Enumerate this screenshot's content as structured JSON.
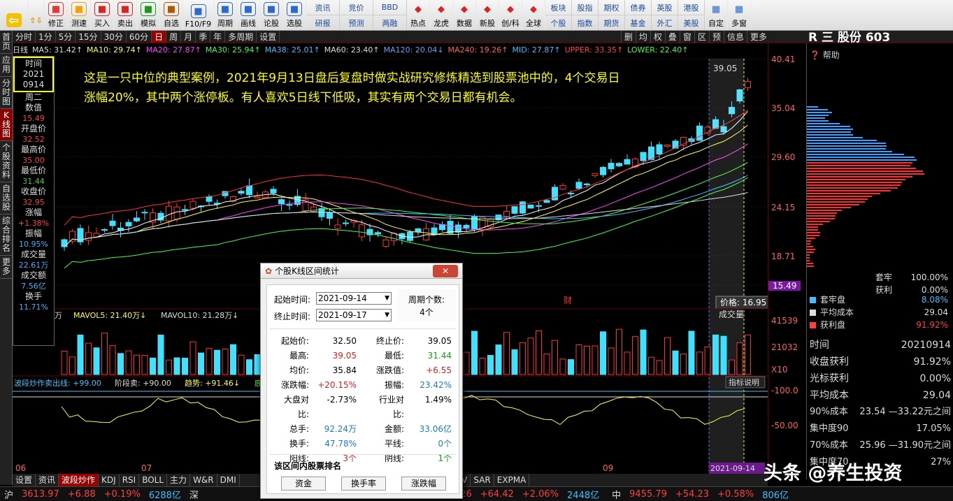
{
  "toolbar": {
    "left_buttons": [
      "修正",
      "测速",
      "买入",
      "卖出",
      "模拟",
      "自选",
      "F10/F9",
      "周期",
      "画线",
      "论股",
      "选股"
    ],
    "pairs": [
      [
        "资讯",
        "研报"
      ],
      [
        "竞价",
        "预测"
      ],
      [
        "BBD",
        "两融"
      ],
      [
        "陆港",
        "热点"
      ],
      [
        "龙虎",
        "数据"
      ],
      [
        "新股",
        "新股"
      ],
      [
        "创/科",
        "创/科"
      ]
    ],
    "more_buttons": [
      "热点",
      "龙虎",
      "数据",
      "新股",
      "创/科",
      "全球"
    ],
    "right_pairs": [
      [
        "板块",
        "个股"
      ],
      [
        "股指",
        "指数"
      ],
      [
        "期权",
        "期货"
      ],
      [
        "债券",
        "基金"
      ],
      [
        "英股",
        "外汇"
      ],
      [
        "港股",
        "美股"
      ]
    ],
    "right_buttons": [
      "自定",
      "多窗"
    ]
  },
  "tabs": [
    "分时",
    "1分",
    "5分",
    "15分",
    "30分",
    "60分",
    "日",
    "周",
    "月",
    "季",
    "年",
    "多周期",
    "设置"
  ],
  "active_tab": "日",
  "tabs_right": [
    "删",
    "均",
    "权",
    "叠",
    "窗",
    "区",
    "预",
    "信息",
    "更多"
  ],
  "leftnav": [
    "首页",
    "应用",
    "分时图",
    "K线图",
    "个股资料",
    "自选股",
    "综合排名",
    "更多"
  ],
  "leftnav_active": "K线图",
  "ma_line": [
    {
      "text": "日线",
      "color": "#ddd"
    },
    {
      "text": "MA5: 31.42↑",
      "color": "#ddd"
    },
    {
      "text": "MA10: 29.74↑",
      "color": "#ffff40"
    },
    {
      "text": "MA20: 27.87↑",
      "color": "#ff40ff"
    },
    {
      "text": "MA30: 25.94↑",
      "color": "#40ff40"
    },
    {
      "text": "MA38: 25.01↑",
      "color": "#40c0ff"
    },
    {
      "text": "MA60: 23.40↑",
      "color": "#ddd"
    },
    {
      "text": "MA120: 20.04↓",
      "color": "#6aa0ff"
    },
    {
      "text": "MA240: 19.26↑",
      "color": "#ff6060"
    },
    {
      "text": "MID: 27.87↑",
      "color": "#40c0ff"
    },
    {
      "text": "UPPER: 33.35↑",
      "color": "#ff4040"
    },
    {
      "text": "LOWER: 22.40↑",
      "color": "#40ff40"
    }
  ],
  "info_panel": {
    "time_label": "时间",
    "year": "2021",
    "date": "0914",
    "weekday": "周二",
    "items": [
      {
        "label": "数值",
        "value": "15.49",
        "cls": ""
      },
      {
        "label": "开盘价",
        "value": "32.52",
        "cls": ""
      },
      {
        "label": "最高价",
        "value": "35.00",
        "cls": ""
      },
      {
        "label": "最低价",
        "value": "31.44",
        "cls": "vg"
      },
      {
        "label": "收盘价",
        "value": "32.95",
        "cls": ""
      },
      {
        "label": "涨幅",
        "value": "+1.38%",
        "cls": ""
      },
      {
        "label": "振幅",
        "value": "10.95%",
        "cls": "vc"
      },
      {
        "label": "成交量",
        "value": "22.61万",
        "cls": "vc"
      },
      {
        "label": "成交额",
        "value": "7.56亿",
        "cls": "vc"
      },
      {
        "label": "换手",
        "value": "11.71%",
        "cls": "vc"
      }
    ]
  },
  "annotation": "这是一只中位的典型案例，2021年9月13日盘后复盘时做实战研究修炼精选到股票池中的，4个交易日涨幅20%，其中两个涨停板。有人喜欢5日线下低吸，其实有两个交易日都有机会。",
  "price_axis": [
    "40.41",
    "35.04",
    "29.60",
    "24.15",
    "18.71",
    "15.49"
  ],
  "vol_axis": [
    "41539",
    "21032",
    "X10"
  ],
  "osc_axis": [
    "100.0",
    "50.00"
  ],
  "chart_labels": {
    "peak": "39.05",
    "price_tip": "价格: 16.95",
    "fin_mark": "财",
    "vol_label": "成交量",
    "indicator_btn": "指标说明",
    "date_highlight": "2021-09-14"
  },
  "vol_legend": [
    {
      "text": "万",
      "color": "#ddd"
    },
    {
      "text": "MAVOL5: 21.40万↓",
      "color": "#ffff40"
    },
    {
      "text": "MAVOL10: 21.28万↓",
      "color": "#ddd"
    }
  ],
  "osc_legend": [
    {
      "text": "波段炒作",
      "color": "#40c0ff"
    },
    {
      "text": "卖出线: +99.00",
      "color": "#40c0ff"
    },
    {
      "text": "阶段卖: +90.00",
      "color": "#ddd"
    },
    {
      "text": "趋势: +91.46↓",
      "color": "#ffff40"
    },
    {
      "text": "底部: +10",
      "color": "#40ff40"
    }
  ],
  "x_labels": [
    "06",
    "07",
    "08",
    "09"
  ],
  "bottom_tabs": [
    "设置",
    "资讯",
    "波段炒作",
    "KDJ",
    "RSI",
    "BOLL",
    "主力",
    "W&R",
    "DMI",
    "BBI",
    "MTM",
    "OBV",
    "SAR",
    "EXPMA"
  ],
  "bottom_tabs_active": "波段炒作",
  "right_panel": {
    "title": "R 三 股份 603",
    "help": "帮助",
    "legend": [
      {
        "label": "套牢",
        "value": "100.00%",
        "color": "#ddd"
      },
      {
        "label": "获利",
        "value": "0.00%",
        "color": "#ddd"
      }
    ],
    "legend2": [
      {
        "label": "套牢盘",
        "value": "8.08%",
        "color": "#40c0ff"
      },
      {
        "label": "平均成本",
        "value": "29.04",
        "color": "#ddd"
      },
      {
        "label": "获利盘",
        "value": "91.92%",
        "color": "#ff4040"
      }
    ],
    "rows": [
      {
        "k": "时间",
        "v": "20210914"
      },
      {
        "k": "收盘获利",
        "v": "91.92%"
      },
      {
        "k": "光标获利",
        "v": "0.00%"
      },
      {
        "k": "平均成本",
        "v": "29.04"
      },
      {
        "k": "90%成本",
        "v": "23.54 —33.22元之间"
      },
      {
        "k": "集中度90",
        "v": "17.05%"
      },
      {
        "k": "70%成本",
        "v": "25.96 —31.90元之间"
      },
      {
        "k": "集中度70",
        "v": "27%"
      }
    ]
  },
  "statusbar": [
    {
      "text": "沪",
      "color": "#ddd"
    },
    {
      "text": "3613.97",
      "color": "#ff4040"
    },
    {
      "text": "+6.88",
      "color": "#ff4040"
    },
    {
      "text": "+0.19%",
      "color": "#ff4040"
    },
    {
      "text": "6288亿",
      "color": "#40c0ff"
    },
    {
      "text": "深",
      "color": "#ddd"
    },
    {
      "text": "创",
      "color": "#ddd"
    },
    {
      "text": "3193.26",
      "color": "#ff4040"
    },
    {
      "text": "+64.42",
      "color": "#ff4040"
    },
    {
      "text": "+2.06%",
      "color": "#ff4040"
    },
    {
      "text": "2448亿",
      "color": "#40c0ff"
    },
    {
      "text": "中",
      "color": "#ddd"
    },
    {
      "text": "9455.79",
      "color": "#ff4040"
    },
    {
      "text": "+54.23",
      "color": "#ff4040"
    },
    {
      "text": "+0.58%",
      "color": "#ff4040"
    },
    {
      "text": "806亿",
      "color": "#40c0ff"
    }
  ],
  "dialog": {
    "title": "个股K线区间统计",
    "start_label": "起始时间:",
    "start_value": "2021-09-14",
    "end_label": "终止时间:",
    "end_value": "2021-09-17",
    "period_label": "周期个数:",
    "period_value": "4个",
    "stats": [
      [
        {
          "k": "起始价:",
          "v": "32.50",
          "c": ""
        },
        {
          "k": "终止价:",
          "v": "39.05",
          "c": ""
        }
      ],
      [
        {
          "k": "最高:",
          "v": "39.05",
          "c": "red"
        },
        {
          "k": "最低:",
          "v": "31.44",
          "c": "green"
        }
      ],
      [
        {
          "k": "均价:",
          "v": "35.84",
          "c": ""
        },
        {
          "k": "涨跌值:",
          "v": "+6.55",
          "c": "red"
        }
      ],
      [
        {
          "k": "涨跌幅:",
          "v": "+20.15%",
          "c": "red"
        },
        {
          "k": "振幅:",
          "v": "23.42%",
          "c": "blue"
        }
      ],
      [
        {
          "k": "大盘对比:",
          "v": "-2.73%",
          "c": ""
        },
        {
          "k": "行业对比:",
          "v": "1.49%",
          "c": ""
        }
      ],
      [
        {
          "k": "总手:",
          "v": "92.24万",
          "c": "blue"
        },
        {
          "k": "金额:",
          "v": "33.06亿",
          "c": "blue"
        }
      ],
      [
        {
          "k": "换手:",
          "v": "47.78%",
          "c": "blue"
        },
        {
          "k": "平线:",
          "v": "0个",
          "c": "blue"
        }
      ],
      [
        {
          "k": "阳线:",
          "v": "3个",
          "c": "red"
        },
        {
          "k": "阴线:",
          "v": "1个",
          "c": "green"
        }
      ]
    ],
    "rank_title": "该区间内股票排名",
    "buttons": [
      "资金",
      "换手率",
      "涨跌幅"
    ]
  },
  "watermark": "头条 @养生投资",
  "colors": {
    "up": "#ff3030",
    "down": "#40e0ff",
    "bg": "#000000",
    "active_tab": "#990000"
  }
}
